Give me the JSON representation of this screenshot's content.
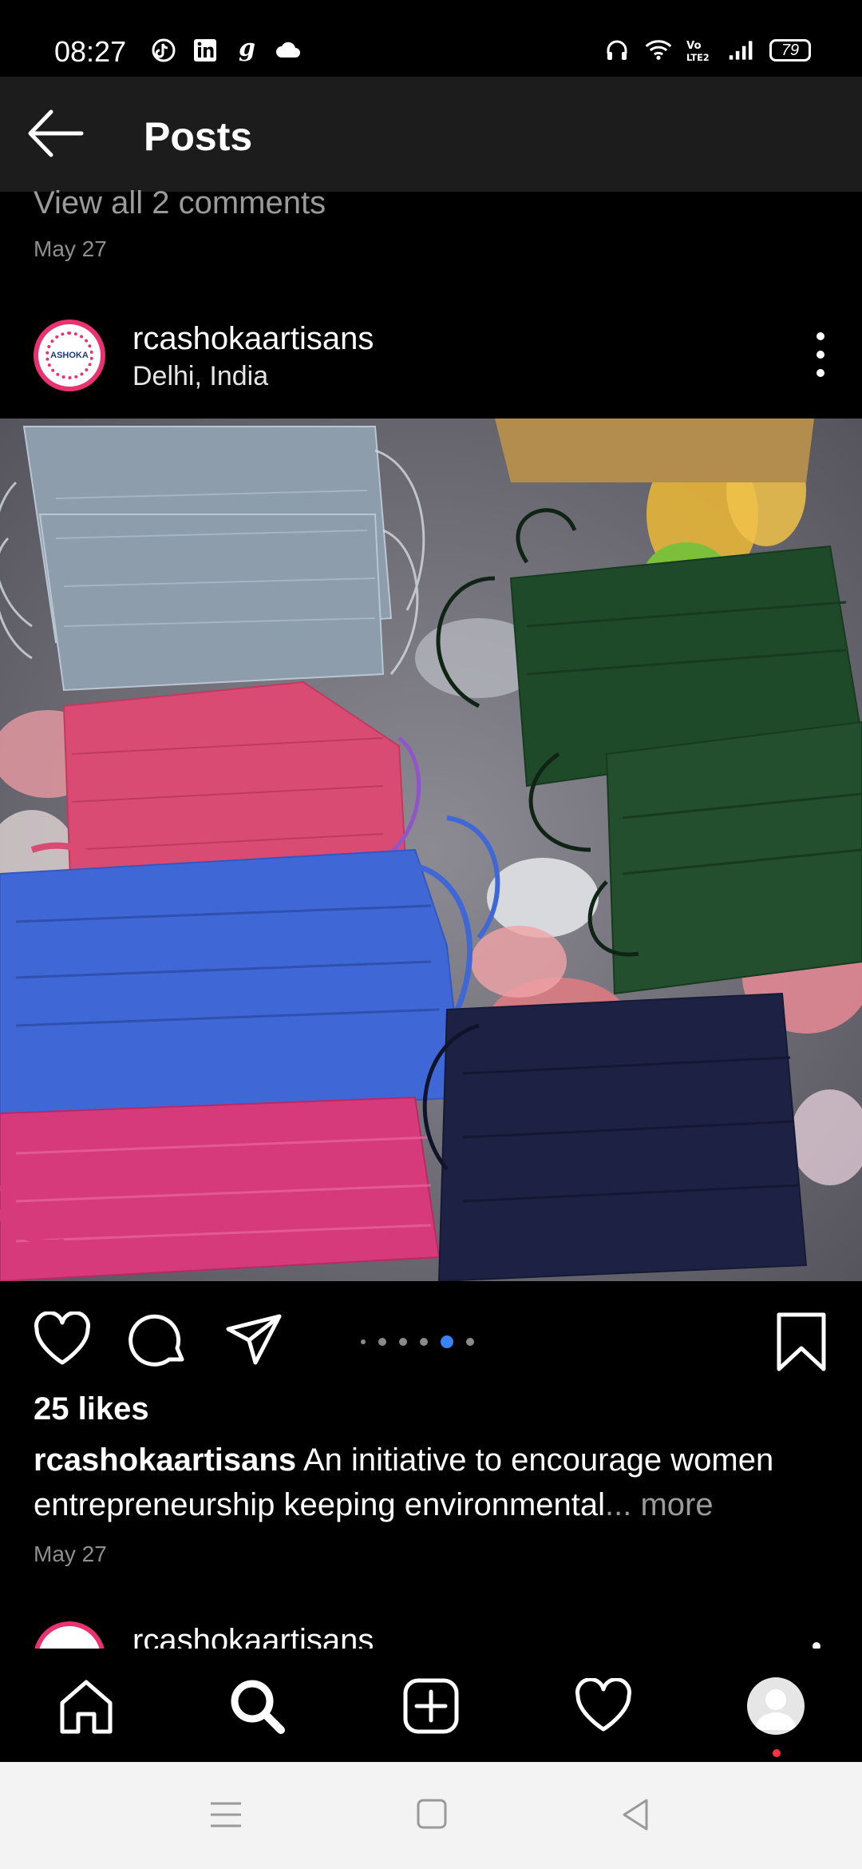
{
  "status_bar": {
    "time": "08:27",
    "left_icons": [
      "tiktok-icon",
      "linkedin-icon",
      "g-icon",
      "cloud-icon"
    ],
    "right_icons": [
      "headphones-icon",
      "wifi-icon",
      "volte-icon",
      "signal-icon"
    ],
    "battery": "79"
  },
  "header": {
    "title": "Posts"
  },
  "previous_post": {
    "view_comments": "View all 2 comments",
    "date": "May 27"
  },
  "post": {
    "username": "rcashokaartisans",
    "location": "Delhi, India",
    "avatar_text": "ASHOKA",
    "likes": "25 likes",
    "caption_user": "rcashokaartisans",
    "caption_text": " An initiative to encourage women entrepreneurship keeping environmental",
    "caption_ellipsis": "...",
    "caption_more": " more",
    "date": "May 27",
    "carousel": {
      "total": 6,
      "active_index": 4
    }
  },
  "next_post": {
    "username": "rcashokaartisans"
  },
  "bottom_nav": {
    "items": [
      "home-icon",
      "search-icon",
      "create-icon",
      "activity-heart-icon",
      "profile-avatar"
    ]
  },
  "colors": {
    "accent_blue": "#3b82f6",
    "notification_red": "#ff3040",
    "avatar_pink": "#e9326f"
  }
}
